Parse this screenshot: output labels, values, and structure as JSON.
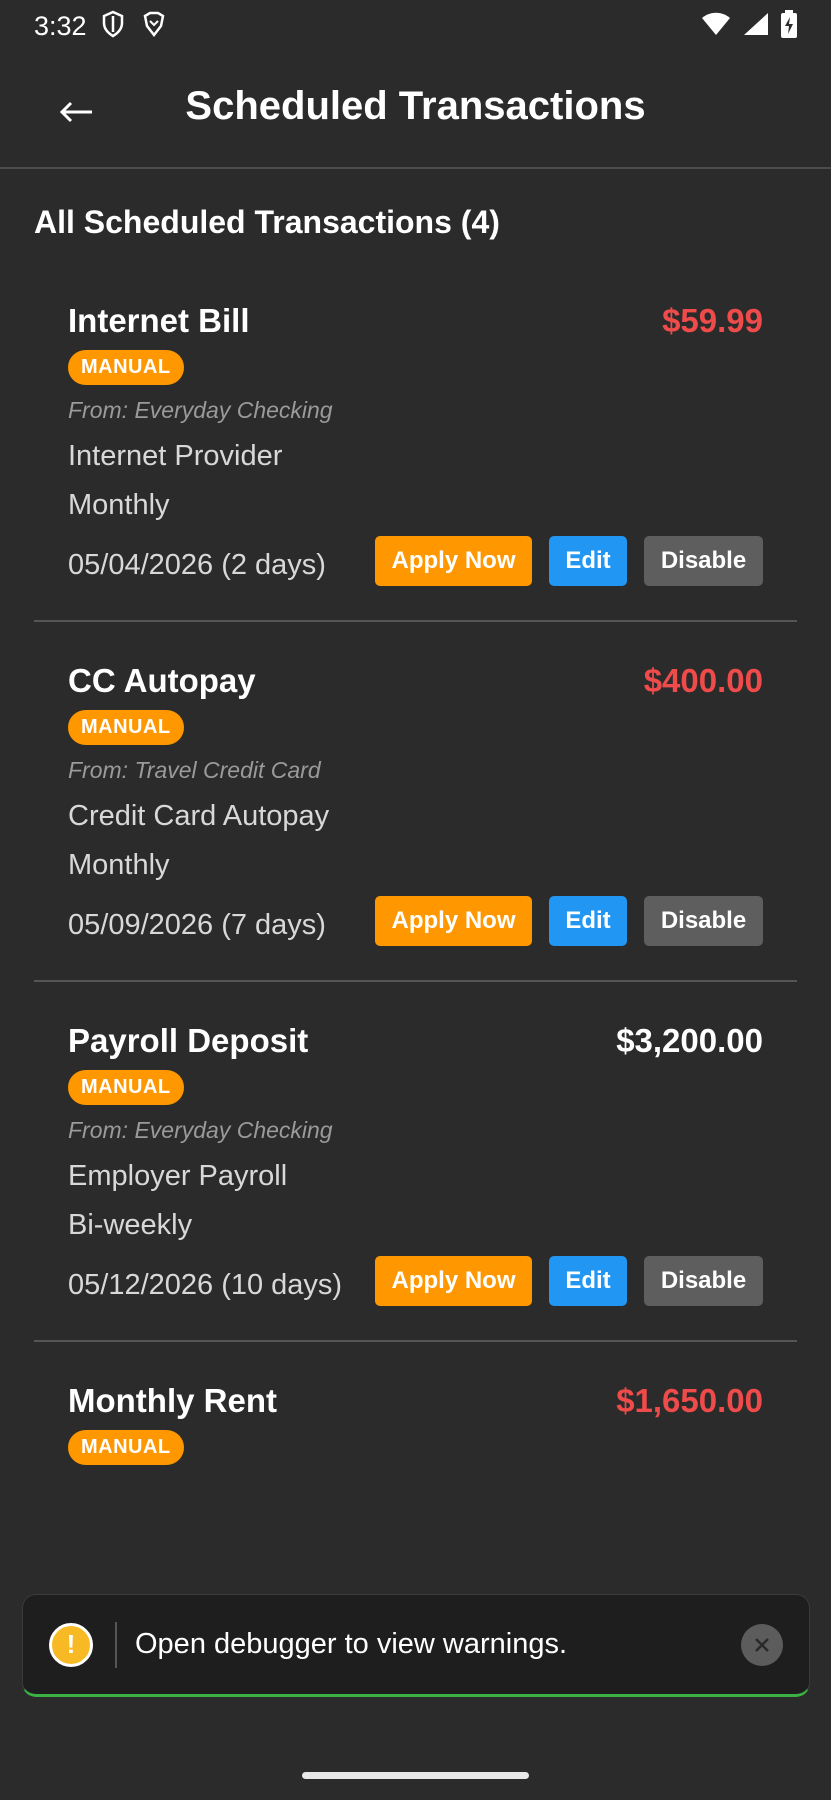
{
  "status_bar": {
    "time": "3:32",
    "icons_left": [
      "shield-icon",
      "brave-icon"
    ],
    "icons_right": [
      "wifi-icon",
      "signal-icon",
      "battery-charging-icon"
    ]
  },
  "header": {
    "back_icon": "arrow-left-icon",
    "title": "Scheduled Transactions"
  },
  "section_title": "All Scheduled Transactions (4)",
  "transactions": [
    {
      "name": "Internet Bill",
      "amount": "$59.99",
      "amount_color": "#ef4b4b",
      "badge": "MANUAL",
      "from": "From: Everyday Checking",
      "payee": "Internet Provider",
      "frequency": "Monthly",
      "date": "05/04/2026 (2 days)"
    },
    {
      "name": "CC Autopay",
      "amount": "$400.00",
      "amount_color": "#ef4b4b",
      "badge": "MANUAL",
      "from": "From: Travel Credit Card",
      "payee": "Credit Card Autopay",
      "frequency": "Monthly",
      "date": "05/09/2026 (7 days)"
    },
    {
      "name": "Payroll Deposit",
      "amount": "$3,200.00",
      "amount_color": "#ffffff",
      "badge": "MANUAL",
      "from": "From: Everyday Checking",
      "payee": "Employer Payroll",
      "frequency": "Bi-weekly",
      "date": "05/12/2026 (10 days)"
    },
    {
      "name": "Monthly Rent",
      "amount": "$1,650.00",
      "amount_color": "#ef4b4b",
      "badge": "MANUAL"
    }
  ],
  "actions": {
    "apply_label": "Apply Now",
    "edit_label": "Edit",
    "disable_label": "Disable"
  },
  "toast": {
    "message": "Open debugger to view warnings.",
    "icon": "warning-icon",
    "close_icon": "close-icon"
  },
  "colors": {
    "background": "#2b2b2b",
    "expense": "#ef4b4b",
    "manual_badge": "#ff9800",
    "apply_button": "#ff9800",
    "edit_button": "#2196f3",
    "disable_button": "#5e5e5e"
  }
}
